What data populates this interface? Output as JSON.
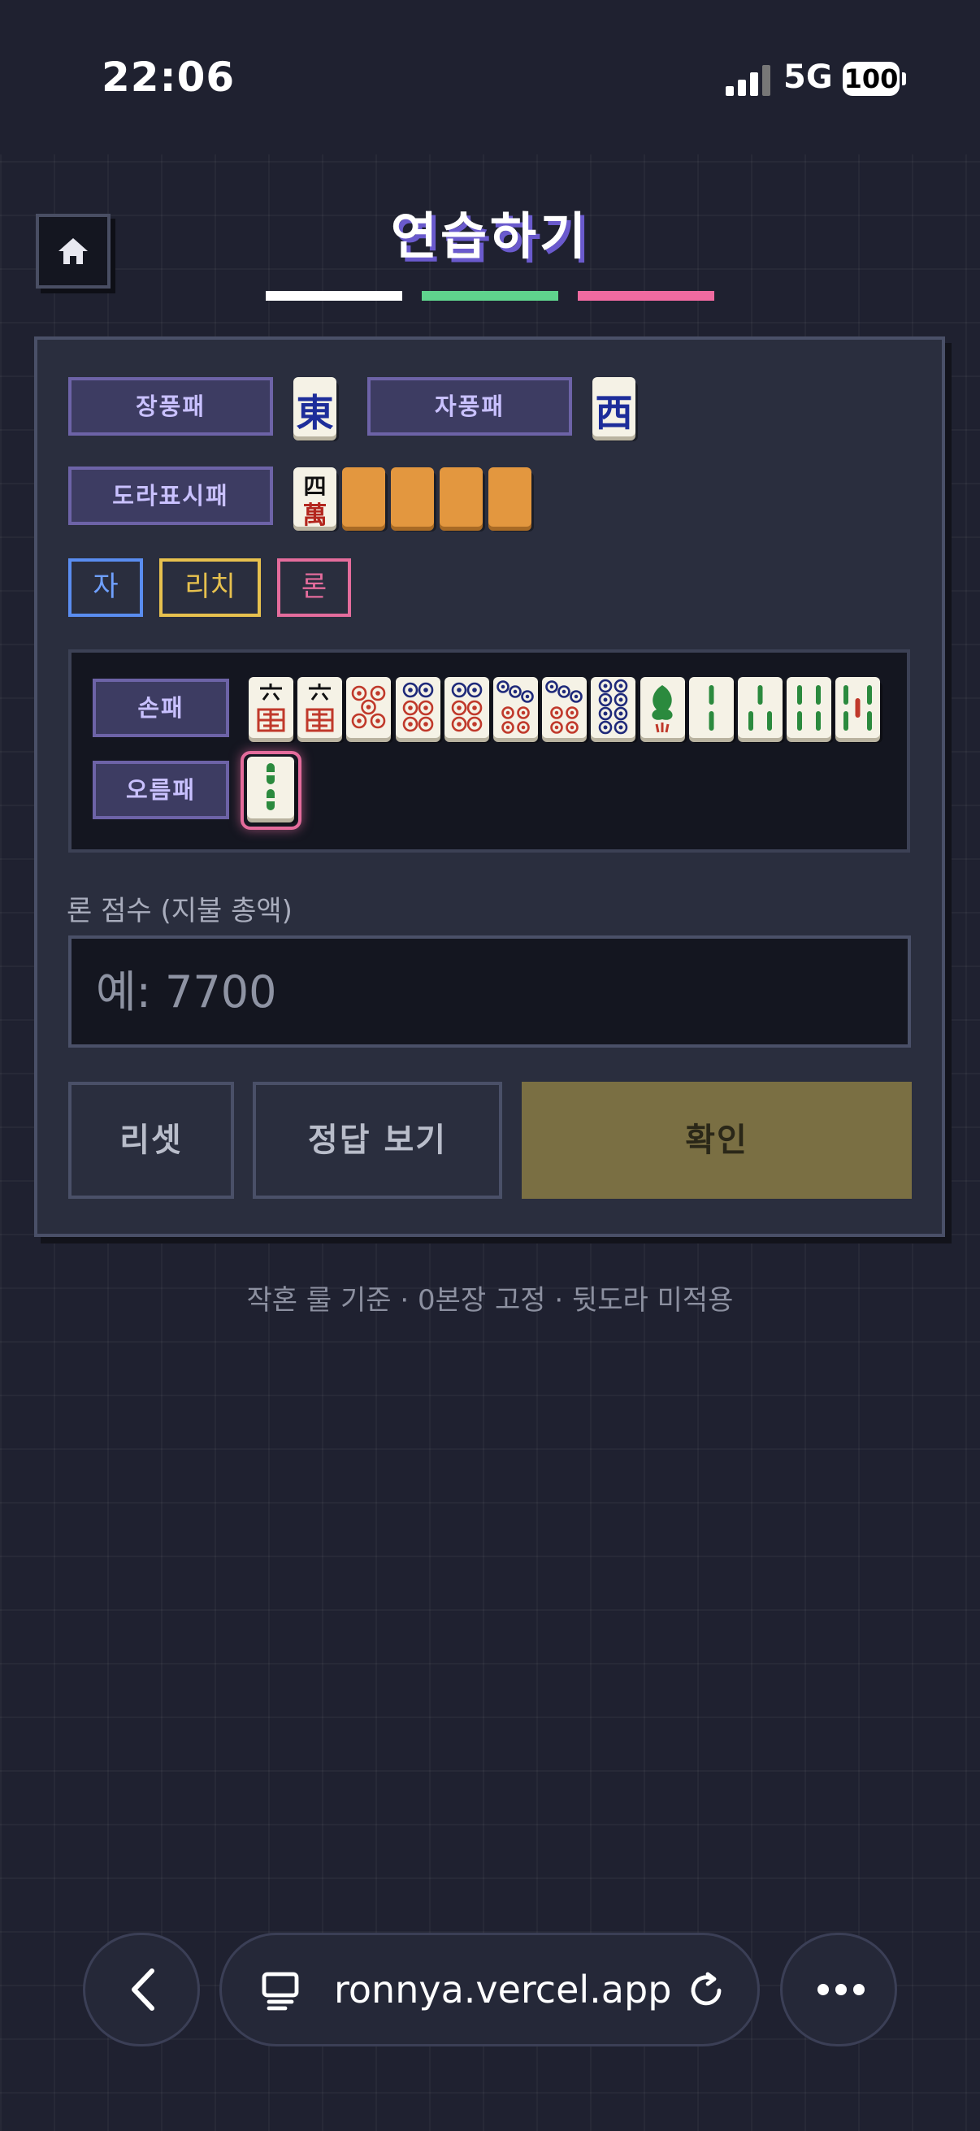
{
  "status_bar": {
    "time": "22:06",
    "network": "5G",
    "battery": "100"
  },
  "header": {
    "title": "연습하기",
    "accent_colors": [
      "#ffffff",
      "#5fd38d",
      "#f06aa0"
    ]
  },
  "winds": {
    "round_wind_label": "장풍패",
    "round_wind_tile": "東",
    "seat_wind_label": "자풍패",
    "seat_wind_tile": "西"
  },
  "dora": {
    "label": "도라표시패",
    "indicator_top": "四",
    "indicator_bottom": "萬"
  },
  "toggles": {
    "self": "자",
    "riichi": "리치",
    "ron": "론"
  },
  "hand": {
    "label": "손패",
    "winning_label": "오름패"
  },
  "score": {
    "label": "론 점수 (지불 총액)",
    "placeholder": "예: 7700"
  },
  "buttons": {
    "reset": "리셋",
    "show_answer": "정답 보기",
    "confirm": "확인"
  },
  "footer": {
    "note": "작혼 룰 기준 · 0본장 고정 · 뒷도라 미적용"
  },
  "browser": {
    "url": "ronnya.vercel.app"
  }
}
